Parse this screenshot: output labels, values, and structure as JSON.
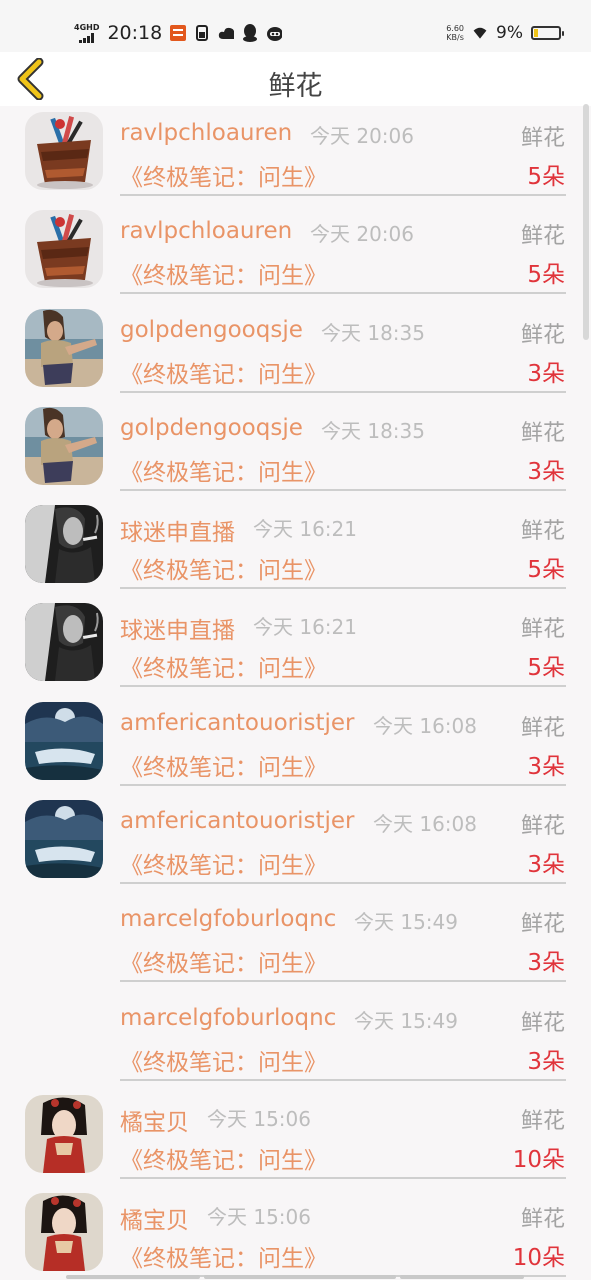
{
  "status_bar": {
    "network": "4GHD",
    "time": "20:18",
    "speed_value": "6.60",
    "speed_unit": "KB/s",
    "battery": "9%",
    "battery_level": 0.09,
    "icons": [
      "signal-icon",
      "app-notification-icon",
      "sim-icon",
      "cloud-icon",
      "qq-icon",
      "cat-icon",
      "wifi-icon",
      "battery-icon"
    ]
  },
  "nav": {
    "title": "鲜花",
    "back_icon": "chevron-left-icon"
  },
  "rows": [
    {
      "user": "ravlpchloauren",
      "time": "今天 20:06",
      "book": "《终极笔记：问生》",
      "gift": "鲜花",
      "count": "5朵",
      "avatar": "pen-holder"
    },
    {
      "user": "ravlpchloauren",
      "time": "今天 20:06",
      "book": "《终极笔记：问生》",
      "gift": "鲜花",
      "count": "5朵",
      "avatar": "pen-holder"
    },
    {
      "user": "golpdengooqsje",
      "time": "今天 18:35",
      "book": "《终极笔记：问生》",
      "gift": "鲜花",
      "count": "3朵",
      "avatar": "beach-girl"
    },
    {
      "user": "golpdengooqsje",
      "time": "今天 18:35",
      "book": "《终极笔记：问生》",
      "gift": "鲜花",
      "count": "3朵",
      "avatar": "beach-girl"
    },
    {
      "user": "球迷申直播",
      "time": "今天 16:21",
      "book": "《终极笔记：问生》",
      "gift": "鲜花",
      "count": "5朵",
      "avatar": "smoker"
    },
    {
      "user": "球迷申直播",
      "time": "今天 16:21",
      "book": "《终极笔记：问生》",
      "gift": "鲜花",
      "count": "5朵",
      "avatar": "smoker"
    },
    {
      "user": "amfericantouoristjer",
      "time": "今天 16:08",
      "book": "《终极笔记：问生》",
      "gift": "鲜花",
      "count": "3朵",
      "avatar": "night-sea"
    },
    {
      "user": "amfericantouoristjer",
      "time": "今天 16:08",
      "book": "《终极笔记：问生》",
      "gift": "鲜花",
      "count": "3朵",
      "avatar": "night-sea"
    },
    {
      "user": "marcelgfoburloqnc",
      "time": "今天 15:49",
      "book": "《终极笔记：问生》",
      "gift": "鲜花",
      "count": "3朵",
      "avatar": "none"
    },
    {
      "user": "marcelgfoburloqnc",
      "time": "今天 15:49",
      "book": "《终极笔记：问生》",
      "gift": "鲜花",
      "count": "3朵",
      "avatar": "none"
    },
    {
      "user": "橘宝贝",
      "time": "今天 15:06",
      "book": "《终极笔记：问生》",
      "gift": "鲜花",
      "count": "10朵",
      "avatar": "ancient-lady"
    },
    {
      "user": "橘宝贝",
      "time": "今天 15:06",
      "book": "《终极笔记：问生》",
      "gift": "鲜花",
      "count": "10朵",
      "avatar": "ancient-lady"
    }
  ],
  "colors": {
    "accent": "#e99467",
    "count": "#e0343b",
    "muted": "#a3a3a3",
    "time": "#bdbdbd",
    "back_icon": "#f0c419"
  }
}
